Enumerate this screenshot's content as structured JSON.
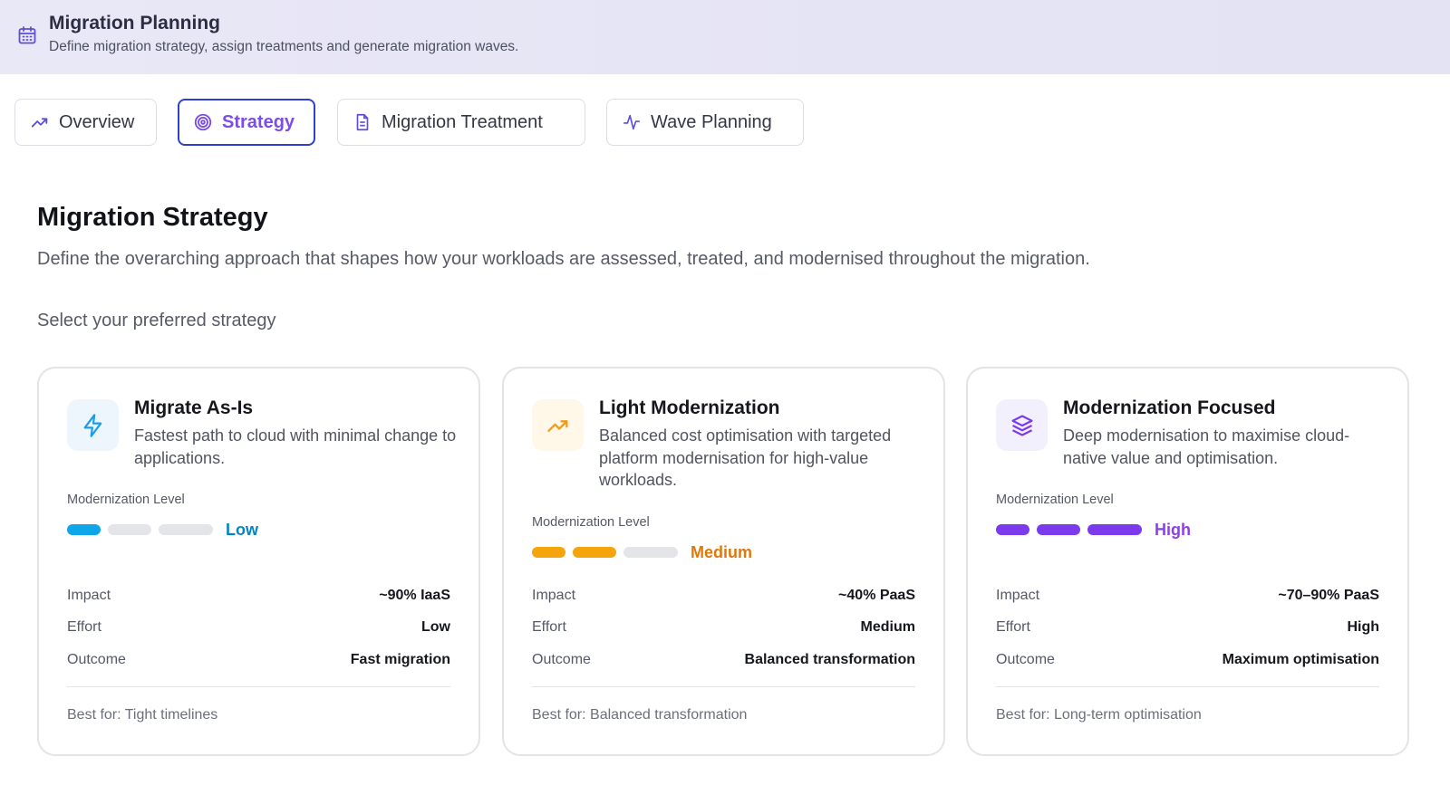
{
  "header": {
    "title": "Migration Planning",
    "subtitle": "Define migration strategy, assign treatments and generate migration waves.",
    "icon": "calendar-icon"
  },
  "tabs": [
    {
      "label": "Overview",
      "icon": "trending-up-icon",
      "active": false
    },
    {
      "label": "Strategy",
      "icon": "target-icon",
      "active": true
    },
    {
      "label": "Migration Treatment",
      "icon": "document-icon",
      "active": false
    },
    {
      "label": "Wave Planning",
      "icon": "activity-icon",
      "active": false
    }
  ],
  "section": {
    "title": "Migration Strategy",
    "description": "Define the overarching approach that shapes how your workloads are assessed, treated, and modernised throughout the migration.",
    "select_label": "Select your preferred strategy"
  },
  "cards": [
    {
      "title": "Migrate As-Is",
      "description": "Fastest path to cloud with minimal change to applications.",
      "icon": "lightning-icon",
      "level_label": "Modernization Level",
      "level": "Low",
      "level_filled": 1,
      "level_total": 3,
      "accent": "#0ea5e9",
      "level_text_color": "#0284c7",
      "icon_bg": "#eef6fd",
      "rows": [
        {
          "key": "Impact",
          "value": "~90% IaaS"
        },
        {
          "key": "Effort",
          "value": "Low"
        },
        {
          "key": "Outcome",
          "value": "Fast migration"
        }
      ],
      "best_for": "Best for: Tight timelines"
    },
    {
      "title": "Light Modernization",
      "description": "Balanced cost optimisation with targeted platform modernisation for high-value workloads.",
      "icon": "trending-up-icon",
      "level_label": "Modernization Level",
      "level": "Medium",
      "level_filled": 2,
      "level_total": 3,
      "accent": "#f5a50b",
      "level_text_color": "#e0780a",
      "icon_bg": "#fff8e8",
      "rows": [
        {
          "key": "Impact",
          "value": "~40% PaaS"
        },
        {
          "key": "Effort",
          "value": "Medium"
        },
        {
          "key": "Outcome",
          "value": "Balanced transformation"
        }
      ],
      "best_for": "Best for: Balanced transformation"
    },
    {
      "title": "Modernization Focused",
      "description": "Deep modernisation to maximise cloud-native value and optimisation.",
      "icon": "layers-icon",
      "level_label": "Modernization Level",
      "level": "High",
      "level_filled": 3,
      "level_total": 3,
      "accent": "#7c3aed",
      "level_text_color": "#8b3df0",
      "icon_bg": "#f3f0fd",
      "rows": [
        {
          "key": "Impact",
          "value": "~70–90% PaaS"
        },
        {
          "key": "Effort",
          "value": "High"
        },
        {
          "key": "Outcome",
          "value": "Maximum optimisation"
        }
      ],
      "best_for": "Best for: Long-term optimisation"
    }
  ]
}
